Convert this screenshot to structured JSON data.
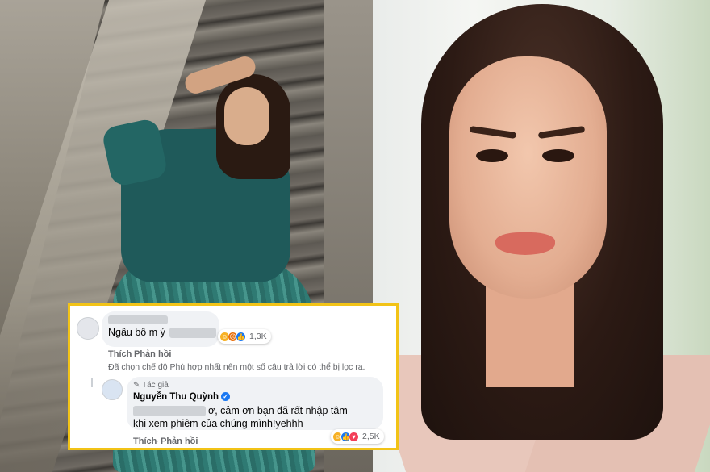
{
  "comment1": {
    "text": "Ngầu bố m ý",
    "reactions": [
      "haha-icon",
      "angry-icon",
      "like-icon"
    ],
    "reaction_count": "1,3K",
    "actions": {
      "like": "Thích",
      "reply": "Phản hồi"
    }
  },
  "filter_notice": "Đã chọn chế độ Phù hợp nhất nên một số câu trả lời có thể bị lọc ra.",
  "reply": {
    "badge": "Tác giả",
    "author": "Nguyễn Thu Quỳnh",
    "text_line1": "ơ, cảm ơn bạn đã rất nhập tâm",
    "text_line2": "khi xem phiêm của chúng mình!yehhh",
    "reactions": [
      "haha-icon",
      "like-icon",
      "love-icon"
    ],
    "reaction_count": "2,5K",
    "actions": {
      "like": "Thích",
      "reply": "Phản hồi"
    }
  },
  "colors": {
    "highlight_border": "#f2c317",
    "facebook_blue": "#1877f2",
    "bubble_bg": "#f0f2f5",
    "meta_text": "#65676b"
  }
}
